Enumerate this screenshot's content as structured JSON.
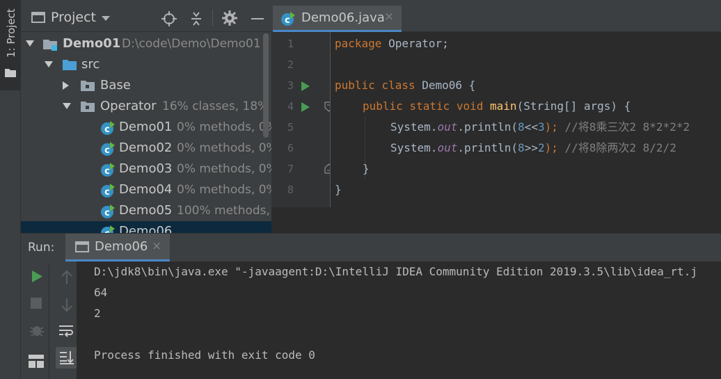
{
  "tool_stripe": {
    "project_label": "1: Project"
  },
  "project": {
    "title": "Project",
    "tree": [
      {
        "name": "Demo01",
        "detail": "D:\\code\\Demo\\Demo01"
      },
      {
        "name": "src",
        "detail": ""
      },
      {
        "name": "Base",
        "detail": ""
      },
      {
        "name": "Operator",
        "detail": "16% classes, 18% l"
      },
      {
        "name": "Demo01",
        "detail": "0% methods, 0%"
      },
      {
        "name": "Demo02",
        "detail": "0% methods, 0%"
      },
      {
        "name": "Demo03",
        "detail": "0% methods, 0%"
      },
      {
        "name": "Demo04",
        "detail": "0% methods, 0%"
      },
      {
        "name": "Demo05",
        "detail": "100% methods,"
      },
      {
        "name": "Demo06",
        "detail": ""
      }
    ]
  },
  "editor": {
    "tab": "Demo06.java",
    "line_numbers": [
      "1",
      "2",
      "3",
      "4",
      "5",
      "6",
      "7",
      "8"
    ],
    "lines": {
      "l1_kw": "package",
      "l1_rest": " Operator;",
      "l3_kw": "public class",
      "l3_rest": " Demo06 {",
      "l4_kw": "public static void",
      "l4_fn": "main",
      "l4_rest": "(String[] args) {",
      "l5_a": "System.",
      "l5_fld": "out",
      "l5_b": ".println(",
      "l5_num1": "8",
      "l5_op": "<<",
      "l5_num2": "3",
      "l5_c": ");",
      "l5_cmt": " //将8乘三次2 8*2*2*2",
      "l6_a": "System.",
      "l6_fld": "out",
      "l6_b": ".println(",
      "l6_num1": "8",
      "l6_op": ">>",
      "l6_num2": "2",
      "l6_c": ");",
      "l6_cmt": " //将8除两次2 8/2/2",
      "l7": "}",
      "l8": "}"
    }
  },
  "run": {
    "label": "Run:",
    "tab": "Demo06",
    "console": [
      "D:\\jdk8\\bin\\java.exe \"-javaagent:D:\\IntelliJ IDEA Community Edition 2019.3.5\\lib\\idea_rt.j",
      "64",
      "2",
      "",
      "Process finished with exit code 0"
    ]
  },
  "colors": {
    "accent": "#4a88c7",
    "run_green": "#499c54",
    "keyword": "#cc7832",
    "number": "#6897bb"
  }
}
